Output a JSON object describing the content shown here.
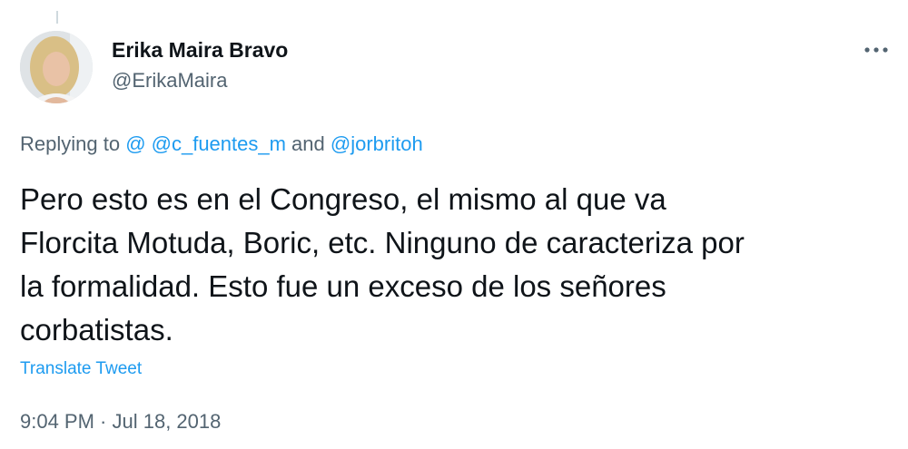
{
  "author": {
    "display_name": "Erika Maira Bravo",
    "handle": "@ErikaMaira",
    "avatar_icon": "profile-photo"
  },
  "more_icon": "more-horizontal-icon",
  "reply_context": {
    "prefix": "Replying to ",
    "mention_1": "@ @c_fuentes_m",
    "joiner": " and ",
    "mention_2": "@jorbritoh"
  },
  "tweet": {
    "lines": [
      "Pero esto es en el Congreso, el mismo al que va",
      "Florcita Motuda, Boric, etc. Ninguno de caracteriza por",
      "la formalidad. Esto fue un exceso de los señores",
      "corbatistas."
    ]
  },
  "translate_label": "Translate Tweet",
  "timestamp": "9:04 PM · Jul 18, 2018",
  "colors": {
    "text": "#0f1419",
    "secondary": "#536471",
    "link": "#1d9bf0"
  }
}
